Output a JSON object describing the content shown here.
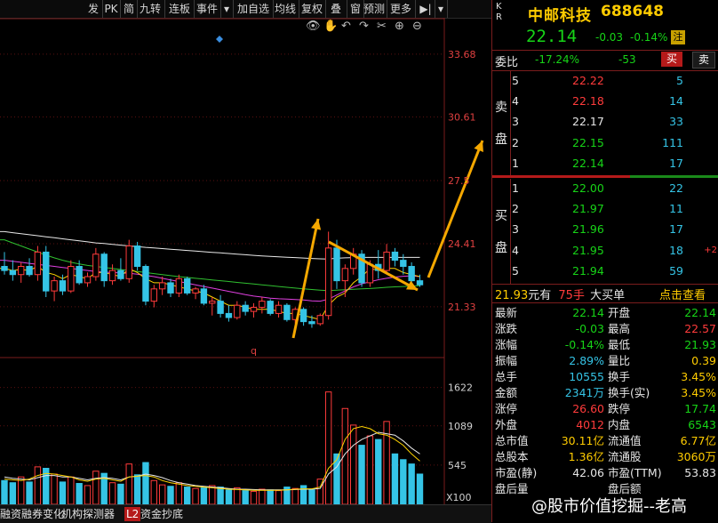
{
  "toolbar": {
    "items": [
      "发",
      "PK",
      "简",
      "九转",
      "连板",
      "事件",
      "▾",
      "加自选",
      "均线",
      "复权",
      "叠",
      "窗",
      "预测",
      "更多",
      "▶|",
      "▾"
    ]
  },
  "chart_icons": [
    "eye-icon",
    "hand-icon",
    "undo-icon",
    "redo-icon",
    "scissors-icon",
    "zoom-in-icon",
    "zoom-out-icon"
  ],
  "price_axis": [
    "33.68",
    "30.61",
    "27.5",
    "24.41",
    "21.33"
  ],
  "volume_axis": [
    "1622",
    "1089",
    "545",
    "X100"
  ],
  "chart_marker": "q",
  "colors": {
    "up": "#ff3b3b",
    "down": "#35c4e6",
    "annot": "#f5a800",
    "ma_white": "#e8e8e8",
    "ma_yellow": "#ffd400",
    "ma_magenta": "#e040e0",
    "ma_green": "#30c030"
  },
  "chart_data": {
    "type": "candlestick",
    "ylim": [
      19.8,
      34.5
    ],
    "volume_ylim": [
      0,
      2000
    ],
    "candles": [
      {
        "o": 23.3,
        "h": 24.0,
        "l": 22.9,
        "c": 23.1,
        "v": 330
      },
      {
        "o": 23.1,
        "h": 23.6,
        "l": 22.6,
        "c": 22.9,
        "v": 300
      },
      {
        "o": 22.9,
        "h": 23.5,
        "l": 22.5,
        "c": 23.3,
        "v": 380
      },
      {
        "o": 23.3,
        "h": 23.7,
        "l": 22.8,
        "c": 22.9,
        "v": 310
      },
      {
        "o": 22.9,
        "h": 24.3,
        "l": 22.6,
        "c": 24.0,
        "v": 520
      },
      {
        "o": 24.0,
        "h": 24.3,
        "l": 21.8,
        "c": 22.1,
        "v": 500
      },
      {
        "o": 22.1,
        "h": 22.8,
        "l": 21.6,
        "c": 22.6,
        "v": 420
      },
      {
        "o": 22.6,
        "h": 22.9,
        "l": 21.9,
        "c": 22.1,
        "v": 310
      },
      {
        "o": 22.1,
        "h": 23.6,
        "l": 22.0,
        "c": 23.3,
        "v": 380
      },
      {
        "o": 23.3,
        "h": 23.6,
        "l": 22.4,
        "c": 22.5,
        "v": 290
      },
      {
        "o": 22.5,
        "h": 23.0,
        "l": 22.3,
        "c": 22.8,
        "v": 260
      },
      {
        "o": 22.8,
        "h": 24.2,
        "l": 22.6,
        "c": 23.9,
        "v": 460
      },
      {
        "o": 23.9,
        "h": 24.0,
        "l": 22.3,
        "c": 22.6,
        "v": 430
      },
      {
        "o": 22.6,
        "h": 23.4,
        "l": 22.4,
        "c": 23.1,
        "v": 300
      },
      {
        "o": 23.1,
        "h": 23.7,
        "l": 22.6,
        "c": 22.7,
        "v": 280
      },
      {
        "o": 22.7,
        "h": 24.6,
        "l": 22.5,
        "c": 24.3,
        "v": 560
      },
      {
        "o": 24.3,
        "h": 24.5,
        "l": 23.1,
        "c": 23.3,
        "v": 410
      },
      {
        "o": 23.3,
        "h": 23.4,
        "l": 21.4,
        "c": 21.6,
        "v": 580
      },
      {
        "o": 21.6,
        "h": 22.4,
        "l": 21.3,
        "c": 22.2,
        "v": 330
      },
      {
        "o": 22.2,
        "h": 22.8,
        "l": 21.9,
        "c": 22.5,
        "v": 270
      },
      {
        "o": 22.5,
        "h": 22.7,
        "l": 21.8,
        "c": 22.0,
        "v": 250
      },
      {
        "o": 22.0,
        "h": 22.9,
        "l": 21.8,
        "c": 22.7,
        "v": 300
      },
      {
        "o": 22.7,
        "h": 22.8,
        "l": 21.9,
        "c": 22.0,
        "v": 240
      },
      {
        "o": 22.0,
        "h": 22.3,
        "l": 21.7,
        "c": 22.2,
        "v": 220
      },
      {
        "o": 22.2,
        "h": 22.4,
        "l": 21.4,
        "c": 21.5,
        "v": 230
      },
      {
        "o": 21.5,
        "h": 21.8,
        "l": 20.9,
        "c": 21.6,
        "v": 260
      },
      {
        "o": 21.6,
        "h": 21.9,
        "l": 20.8,
        "c": 21.0,
        "v": 240
      },
      {
        "o": 21.0,
        "h": 21.4,
        "l": 20.6,
        "c": 20.8,
        "v": 200
      },
      {
        "o": 20.8,
        "h": 21.6,
        "l": 20.7,
        "c": 21.4,
        "v": 230
      },
      {
        "o": 21.4,
        "h": 21.6,
        "l": 20.9,
        "c": 21.1,
        "v": 190
      },
      {
        "o": 21.1,
        "h": 21.5,
        "l": 20.8,
        "c": 21.3,
        "v": 180
      },
      {
        "o": 21.3,
        "h": 21.8,
        "l": 21.0,
        "c": 21.6,
        "v": 210
      },
      {
        "o": 21.6,
        "h": 21.7,
        "l": 20.9,
        "c": 21.0,
        "v": 200
      },
      {
        "o": 21.0,
        "h": 21.6,
        "l": 20.8,
        "c": 21.4,
        "v": 190
      },
      {
        "o": 21.4,
        "h": 21.5,
        "l": 20.6,
        "c": 20.7,
        "v": 240
      },
      {
        "o": 20.7,
        "h": 21.3,
        "l": 20.5,
        "c": 21.2,
        "v": 220
      },
      {
        "o": 21.2,
        "h": 21.3,
        "l": 20.4,
        "c": 20.6,
        "v": 260
      },
      {
        "o": 20.6,
        "h": 20.9,
        "l": 20.3,
        "c": 20.5,
        "v": 200
      },
      {
        "o": 20.5,
        "h": 21.0,
        "l": 20.4,
        "c": 20.9,
        "v": 350
      },
      {
        "o": 20.9,
        "h": 25.0,
        "l": 20.7,
        "c": 24.2,
        "v": 1560
      },
      {
        "o": 24.2,
        "h": 24.6,
        "l": 22.2,
        "c": 22.6,
        "v": 700
      },
      {
        "o": 22.6,
        "h": 23.4,
        "l": 21.8,
        "c": 23.2,
        "v": 1330
      },
      {
        "o": 23.2,
        "h": 24.2,
        "l": 22.9,
        "c": 23.9,
        "v": 1100
      },
      {
        "o": 23.9,
        "h": 24.1,
        "l": 22.3,
        "c": 22.5,
        "v": 820
      },
      {
        "o": 22.5,
        "h": 23.6,
        "l": 22.3,
        "c": 23.4,
        "v": 950
      },
      {
        "o": 23.4,
        "h": 24.1,
        "l": 22.7,
        "c": 23.1,
        "v": 900
      },
      {
        "o": 23.1,
        "h": 24.4,
        "l": 23.0,
        "c": 24.0,
        "v": 1150
      },
      {
        "o": 24.0,
        "h": 24.2,
        "l": 23.3,
        "c": 23.6,
        "v": 700
      },
      {
        "o": 23.6,
        "h": 23.9,
        "l": 22.9,
        "c": 23.3,
        "v": 620
      },
      {
        "o": 23.3,
        "h": 23.5,
        "l": 22.4,
        "c": 22.6,
        "v": 560
      },
      {
        "o": 22.6,
        "h": 22.9,
        "l": 22.3,
        "c": 22.4,
        "v": 420
      }
    ],
    "ma_white": [
      25.0,
      24.95,
      24.9,
      24.85,
      24.8,
      24.75,
      24.7,
      24.65,
      24.6,
      24.55,
      24.5,
      24.45,
      24.42,
      24.38,
      24.34,
      24.3,
      24.27,
      24.23,
      24.2,
      24.17,
      24.14,
      24.11,
      24.08,
      24.05,
      24.02,
      23.99,
      23.96,
      23.93,
      23.9,
      23.87,
      23.84,
      23.81,
      23.79,
      23.77,
      23.75,
      23.73,
      23.71,
      23.69,
      23.67,
      23.66,
      23.7,
      23.72,
      23.73,
      23.74,
      23.74,
      23.74,
      23.74,
      23.74,
      23.74,
      23.74,
      23.74
    ],
    "ma_green": [
      24.6,
      24.45,
      24.3,
      24.15,
      24.0,
      23.85,
      23.72,
      23.6,
      23.5,
      23.42,
      23.35,
      23.3,
      23.25,
      23.2,
      23.15,
      23.1,
      23.05,
      23.0,
      22.95,
      22.9,
      22.85,
      22.8,
      22.76,
      22.72,
      22.68,
      22.64,
      22.6,
      22.56,
      22.52,
      22.48,
      22.44,
      22.4,
      22.36,
      22.32,
      22.28,
      22.24,
      22.2,
      22.17,
      22.14,
      22.12,
      22.14,
      22.16,
      22.18,
      22.2,
      22.22,
      22.25,
      22.28,
      22.3,
      22.32,
      22.34,
      22.36
    ],
    "ma_magenta": [
      23.6,
      23.55,
      23.5,
      23.45,
      23.4,
      23.35,
      23.3,
      23.25,
      23.2,
      23.15,
      23.1,
      23.05,
      23.02,
      23.0,
      22.98,
      22.96,
      22.92,
      22.86,
      22.8,
      22.72,
      22.64,
      22.56,
      22.48,
      22.4,
      22.32,
      22.24,
      22.16,
      22.08,
      22.0,
      21.92,
      21.85,
      21.8,
      21.75,
      21.72,
      21.7,
      21.68,
      21.66,
      21.62,
      21.6,
      21.7,
      21.9,
      22.1,
      22.3,
      22.45,
      22.55,
      22.65,
      22.72,
      22.78,
      22.82,
      22.84,
      22.8
    ],
    "ma_yellow": [
      23.2,
      23.1,
      23.15,
      23.1,
      23.3,
      23.0,
      22.9,
      22.7,
      22.9,
      22.8,
      22.7,
      23.0,
      23.0,
      22.9,
      22.8,
      23.2,
      23.0,
      22.7,
      22.5,
      22.5,
      22.4,
      22.3,
      22.2,
      22.1,
      22.0,
      21.8,
      21.6,
      21.4,
      21.4,
      21.3,
      21.2,
      21.2,
      21.2,
      21.1,
      21.0,
      21.0,
      20.9,
      20.8,
      20.7,
      21.4,
      21.8,
      22.0,
      22.5,
      22.8,
      23.2,
      23.1,
      23.2,
      23.2,
      23.0,
      22.9,
      22.8
    ],
    "vol_ma_white": [
      380,
      360,
      350,
      340,
      370,
      400,
      400,
      380,
      380,
      360,
      340,
      360,
      370,
      360,
      340,
      380,
      390,
      420,
      400,
      370,
      330,
      300,
      280,
      260,
      250,
      240,
      230,
      220,
      210,
      210,
      205,
      200,
      200,
      200,
      200,
      205,
      210,
      210,
      220,
      420,
      520,
      700,
      820,
      900,
      950,
      1000,
      980,
      960,
      880,
      780,
      700
    ],
    "vol_ma_yellow": [
      350,
      340,
      330,
      350,
      400,
      430,
      420,
      400,
      380,
      340,
      320,
      350,
      360,
      340,
      320,
      380,
      390,
      400,
      380,
      330,
      300,
      280,
      260,
      250,
      240,
      230,
      220,
      210,
      205,
      200,
      195,
      195,
      195,
      195,
      200,
      210,
      215,
      215,
      240,
      500,
      620,
      900,
      1050,
      1080,
      1050,
      980,
      960,
      900,
      820,
      700,
      600
    ]
  },
  "stock": {
    "name": "中邮科技",
    "code": "688648",
    "side_tag": "K R",
    "price": "22.14",
    "change": "-0.03",
    "pct": "-0.14%",
    "badge": "注"
  },
  "weibi": {
    "label": "委比",
    "pct": "-17.24%",
    "diff": "-53",
    "buy_btn": "买",
    "sell_btn": "卖"
  },
  "sell_label": [
    "卖",
    "盘"
  ],
  "buy_label": [
    "买",
    "盘"
  ],
  "sell_orders": [
    {
      "lvl": "5",
      "price": "22.22",
      "vol": "5",
      "chg": ""
    },
    {
      "lvl": "4",
      "price": "22.18",
      "vol": "14",
      "chg": ""
    },
    {
      "lvl": "3",
      "price": "22.17",
      "vol": "33",
      "chg": ""
    },
    {
      "lvl": "2",
      "price": "22.15",
      "vol": "111",
      "chg": ""
    },
    {
      "lvl": "1",
      "price": "22.14",
      "vol": "17",
      "chg": ""
    }
  ],
  "buy_orders": [
    {
      "lvl": "1",
      "price": "22.00",
      "vol": "22",
      "chg": ""
    },
    {
      "lvl": "2",
      "price": "21.97",
      "vol": "11",
      "chg": ""
    },
    {
      "lvl": "3",
      "price": "21.96",
      "vol": "17",
      "chg": ""
    },
    {
      "lvl": "4",
      "price": "21.95",
      "vol": "18",
      "chg": "+2"
    },
    {
      "lvl": "5",
      "price": "21.94",
      "vol": "59",
      "chg": ""
    }
  ],
  "trade_line": {
    "price": "21.93",
    "you": "元有",
    "hands": "75手",
    "big": "大买单",
    "click": "点击查看"
  },
  "stats": [
    {
      "l1": "最新",
      "v1": "22.14",
      "c1": "green",
      "l2": "开盘",
      "v2": "22.14",
      "c2": "green"
    },
    {
      "l1": "涨跌",
      "v1": "-0.03",
      "c1": "green",
      "l2": "最高",
      "v2": "22.57",
      "c2": "red"
    },
    {
      "l1": "涨幅",
      "v1": "-0.14%",
      "c1": "green",
      "l2": "最低",
      "v2": "21.93",
      "c2": "green"
    },
    {
      "l1": "振幅",
      "v1": "2.89%",
      "c1": "cyan",
      "l2": "量比",
      "v2": "0.39",
      "c2": "yellow"
    },
    {
      "l1": "总手",
      "v1": "10555",
      "c1": "cyan",
      "l2": "换手",
      "v2": "3.45%",
      "c2": "yellow"
    },
    {
      "l1": "金额",
      "v1": "2341万",
      "c1": "cyan",
      "l2": "换手(实)",
      "v2": "3.45%",
      "c2": "yellow"
    },
    {
      "l1": "涨停",
      "v1": "26.60",
      "c1": "red",
      "l2": "跌停",
      "v2": "17.74",
      "c2": "green"
    },
    {
      "l1": "外盘",
      "v1": "4012",
      "c1": "red",
      "l2": "内盘",
      "v2": "6543",
      "c2": "green"
    },
    {
      "l1": "总市值",
      "v1": "30.11亿",
      "c1": "yellow",
      "l2": "流通值",
      "v2": "6.77亿",
      "c2": "yellow"
    },
    {
      "l1": "总股本",
      "v1": "1.36亿",
      "c1": "yellow",
      "l2": "流通股",
      "v2": "3060万",
      "c2": "yellow"
    },
    {
      "l1": "市盈(静)",
      "v1": "42.06",
      "c1": "white",
      "l2": "市盈(TTM)",
      "v2": "53.83",
      "c2": "white"
    },
    {
      "l1": "盘后量",
      "v1": "",
      "c1": "white",
      "l2": "盘后额",
      "v2": "",
      "c2": "white"
    }
  ],
  "footer": {
    "items": [
      "融资融券变化",
      "机构探测器",
      "L2",
      "资金抄底"
    ]
  },
  "watermark": "@股市价值挖掘--老高"
}
